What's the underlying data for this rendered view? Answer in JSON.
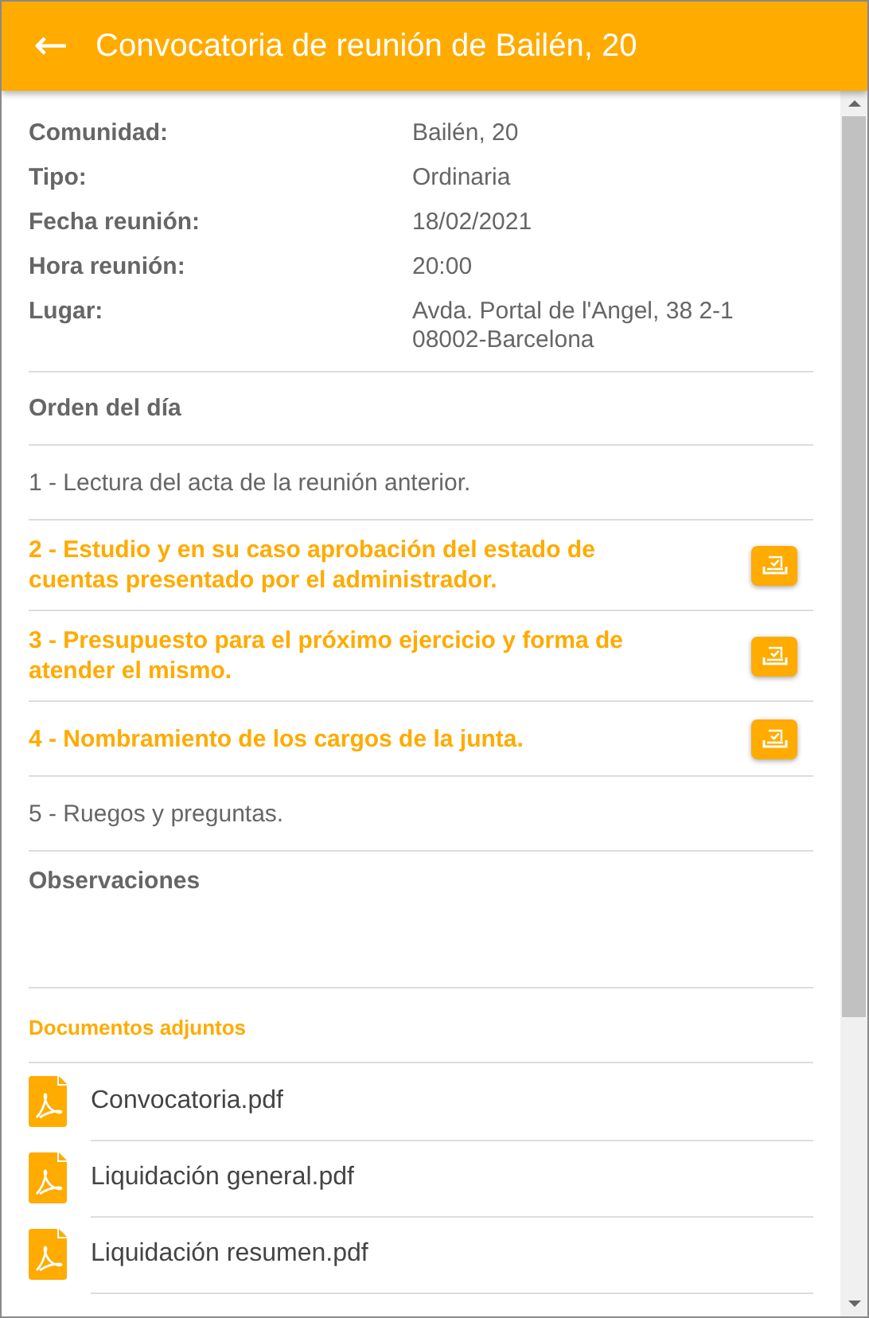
{
  "header": {
    "back_icon": "←",
    "title": "Convocatoria de reunión de Bailén, 20"
  },
  "details": [
    {
      "label": "Comunidad:",
      "value": "Bailén, 20"
    },
    {
      "label": "Tipo:",
      "value": "Ordinaria"
    },
    {
      "label": "Fecha reunión:",
      "value": "18/02/2021"
    },
    {
      "label": "Hora reunión:",
      "value": "20:00"
    },
    {
      "label": "Lugar:",
      "value": "Avda. Portal de l'Angel, 38 2-1\n08002-Barcelona"
    }
  ],
  "agenda": {
    "title": "Orden del día",
    "items": [
      {
        "kind": "plain",
        "text": "1 - Lectura del acta de la reunión anterior."
      },
      {
        "kind": "vote",
        "text": "2 - Estudio y en su caso aprobación del estado de cuentas presentado por el administrador."
      },
      {
        "kind": "vote",
        "text": "3 - Presupuesto para el próximo ejercicio y forma de atender el mismo."
      },
      {
        "kind": "vote",
        "text": "4 - Nombramiento de los cargos de la junta."
      },
      {
        "kind": "plain",
        "text": "5 - Ruegos y preguntas."
      }
    ]
  },
  "observations": {
    "title": "Observaciones"
  },
  "documents": {
    "title": "Documentos adjuntos",
    "files": [
      {
        "name": "Convocatoria.pdf"
      },
      {
        "name": "Liquidación general.pdf"
      },
      {
        "name": "Liquidación resumen.pdf"
      }
    ]
  }
}
